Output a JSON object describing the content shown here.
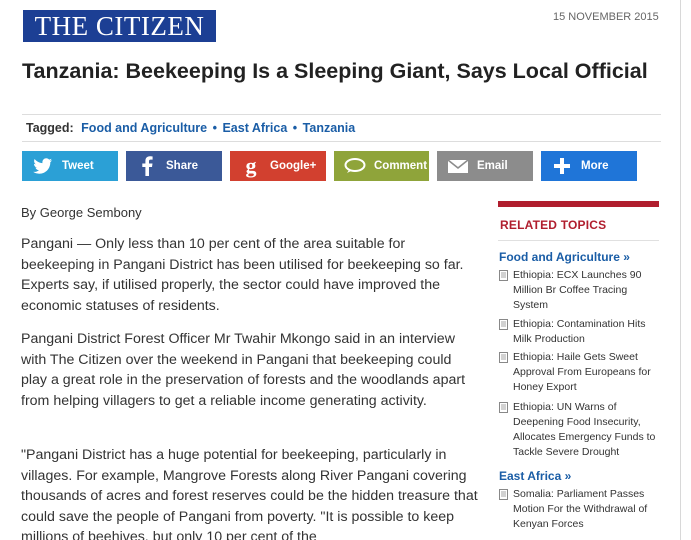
{
  "masthead": {
    "logo": "THE CITIZEN",
    "date": "15 NOVEMBER 2015"
  },
  "article": {
    "title": "Tanzania: Beekeeping Is a Sleeping Giant, Says Local Official",
    "tagged_label": "Tagged:",
    "tags": [
      "Food and Agriculture",
      "East Africa",
      "Tanzania"
    ],
    "byline": "By George Sembony",
    "paragraphs": [
      "Pangani — Only less than 10 per cent of the area suitable for beekeeping in Pangani District has been utilised for beekeeping so far. Experts say, if utilised properly, the sector could have improved the economic statuses of residents.",
      "Pangani District Forest Officer Mr Twahir Mkongo said in an interview with The Citizen over the weekend in Pangani that beekeeping could play a great role in the preservation of forests and the woodlands apart from helping villagers to get a reliable income generating activity.",
      "\"Pangani District has a huge potential for beekeeping, particularly in villages. For example, Mangrove Forests along River Pangani covering thousands of acres and forest reserves could be the hidden treasure that could save the people of Pangani from poverty. \"It is possible to keep millions of beehives, but only 10 per cent of the"
    ]
  },
  "share": [
    {
      "label": "Tweet",
      "icon": "twitter-icon",
      "color": "#2ba0d6"
    },
    {
      "label": "Share",
      "icon": "facebook-icon",
      "color": "#3b5998"
    },
    {
      "label": "Google+",
      "icon": "google-plus-icon",
      "color": "#d2402f"
    },
    {
      "label": "Comment",
      "icon": "comment-icon",
      "color": "#8fa43a"
    },
    {
      "label": "Email",
      "icon": "email-icon",
      "color": "#8c8c8c"
    },
    {
      "label": "More",
      "icon": "plus-icon",
      "color": "#1f75d8"
    }
  ],
  "sidebar": {
    "heading": "RELATED TOPICS",
    "categories": [
      {
        "name": "Food and Agriculture »",
        "items": [
          "Ethiopia: ECX Launches 90 Million Br Coffee Tracing System",
          "Ethiopia: Contamination Hits Milk Production",
          "Ethiopia: Haile Gets Sweet Approval From Europeans for Honey Export",
          "Ethiopia: UN Warns of Deepening Food Insecurity, Allocates Emergency Funds to Tackle Severe Drought"
        ]
      },
      {
        "name": "East Africa »",
        "items": [
          "Somalia: Parliament Passes Motion For the Withdrawal of Kenyan Forces"
        ]
      }
    ]
  },
  "colors": {
    "logo_bg": "#1c3f94",
    "link": "#1a5da6",
    "accent": "#b01e2e"
  }
}
